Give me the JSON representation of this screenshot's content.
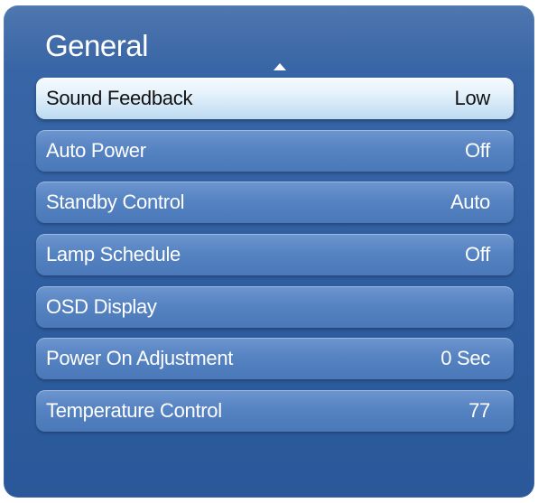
{
  "menu": {
    "title": "General",
    "items": [
      {
        "label": "Sound Feedback",
        "value": "Low",
        "selected": true
      },
      {
        "label": "Auto Power",
        "value": "Off"
      },
      {
        "label": "Standby Control",
        "value": "Auto"
      },
      {
        "label": "Lamp Schedule",
        "value": "Off"
      },
      {
        "label": "OSD Display",
        "value": ""
      },
      {
        "label": "Power On Adjustment",
        "value": "0 Sec"
      },
      {
        "label": "Temperature Control",
        "value": "77"
      }
    ]
  },
  "icons": {
    "scroll_up": "triangle-up-icon"
  },
  "colors": {
    "panel_blue": "#3563a5",
    "item_blue": "#5683c2",
    "selected_item": "#e4f1fb"
  }
}
